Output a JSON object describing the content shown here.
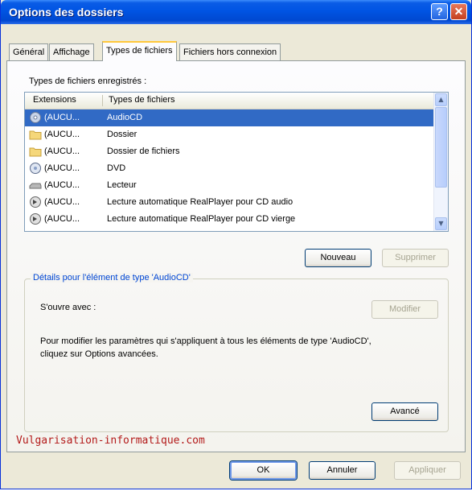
{
  "window": {
    "title": "Options des dossiers",
    "help_glyph": "?",
    "close_glyph": "✕"
  },
  "tabs": [
    {
      "label": "Général",
      "active": false
    },
    {
      "label": "Affichage",
      "active": false
    },
    {
      "label": "Types de fichiers",
      "active": true
    },
    {
      "label": "Fichiers hors connexion",
      "active": false
    }
  ],
  "registered": {
    "label": "Types de fichiers enregistrés :",
    "columns": [
      "Extensions",
      "Types de fichiers"
    ],
    "rows": [
      {
        "ext": "(AUCU...",
        "type": "AudioCD",
        "icon": "audio-cd-icon",
        "selected": true
      },
      {
        "ext": "(AUCU...",
        "type": "Dossier",
        "icon": "folder-icon",
        "selected": false
      },
      {
        "ext": "(AUCU...",
        "type": "Dossier de fichiers",
        "icon": "folder-icon",
        "selected": false
      },
      {
        "ext": "(AUCU...",
        "type": "DVD",
        "icon": "dvd-icon",
        "selected": false
      },
      {
        "ext": "(AUCU...",
        "type": "Lecteur",
        "icon": "drive-icon",
        "selected": false
      },
      {
        "ext": "(AUCU...",
        "type": "Lecture automatique RealPlayer pour CD audio",
        "icon": "realplayer-icon",
        "selected": false
      },
      {
        "ext": "(AUCU...",
        "type": "Lecture automatique RealPlayer pour CD vierge",
        "icon": "realplayer-icon",
        "selected": false
      }
    ]
  },
  "buttons": {
    "new": "Nouveau",
    "delete": "Supprimer",
    "modify": "Modifier",
    "advanced": "Avancé",
    "ok": "OK",
    "cancel": "Annuler",
    "apply": "Appliquer"
  },
  "details": {
    "title": "Détails pour l'élément de type 'AudioCD'",
    "opens_with": "S'ouvre avec :",
    "description_line1": "Pour modifier les paramètres qui s'appliquent à tous les éléments de type 'AudioCD',",
    "description_line2": "cliquez sur Options avancées."
  },
  "watermark": "Vulgarisation-informatique.com",
  "colors": {
    "titlebar": "#0054e3",
    "selection": "#316ac5",
    "group_title": "#0046d5",
    "watermark": "#b31a1a"
  }
}
